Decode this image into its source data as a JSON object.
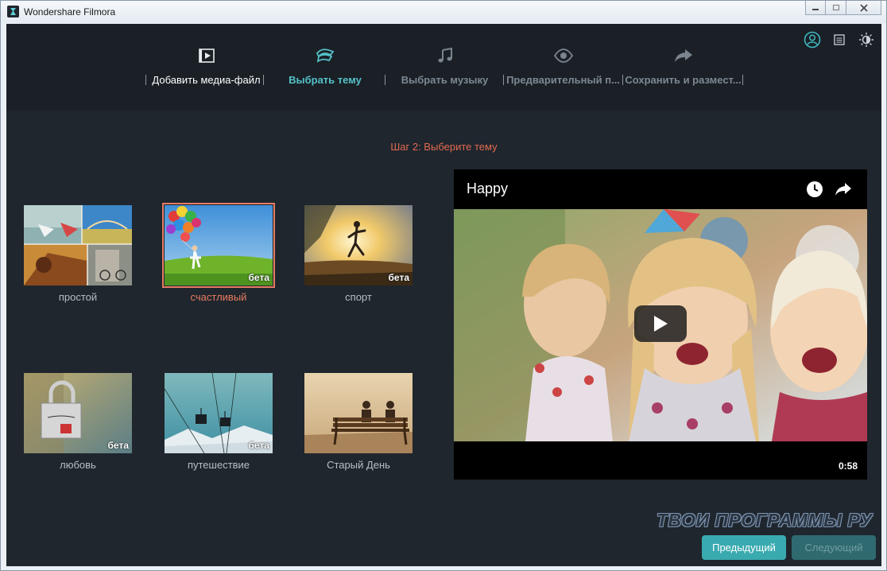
{
  "window": {
    "title": "Wondershare Filmora"
  },
  "steps": [
    {
      "label": "Добавить медиа-файл",
      "icon": "film-icon",
      "state": "done"
    },
    {
      "label": "Выбрать тему",
      "icon": "theme-icon",
      "state": "active"
    },
    {
      "label": "Выбрать музыку",
      "icon": "music-icon",
      "state": "pending"
    },
    {
      "label": "Предварительный п...",
      "icon": "eye-icon",
      "state": "pending"
    },
    {
      "label": "Сохранить и размест...",
      "icon": "share-icon",
      "state": "pending"
    }
  ],
  "step_heading": "Шаг 2: Выберите тему",
  "themes": [
    {
      "label": "простой",
      "badge": "",
      "selected": false
    },
    {
      "label": "счастливый",
      "badge": "бета",
      "selected": true
    },
    {
      "label": "спорт",
      "badge": "бета",
      "selected": false
    },
    {
      "label": "любовь",
      "badge": "бета",
      "selected": false
    },
    {
      "label": "путешествие",
      "badge": "бета",
      "selected": false
    },
    {
      "label": "Старый День",
      "badge": "",
      "selected": false
    }
  ],
  "player": {
    "title": "Happy",
    "duration": "0:58"
  },
  "watermark": "ТВОИ ПРОГРАММЫ РУ",
  "buttons": {
    "prev": "Предыдущий",
    "next": "Следующий"
  },
  "colors": {
    "accent": "#39aab0",
    "active_step": "#55c0c8",
    "heading": "#e26a52",
    "selected_theme": "#e87a5f"
  }
}
